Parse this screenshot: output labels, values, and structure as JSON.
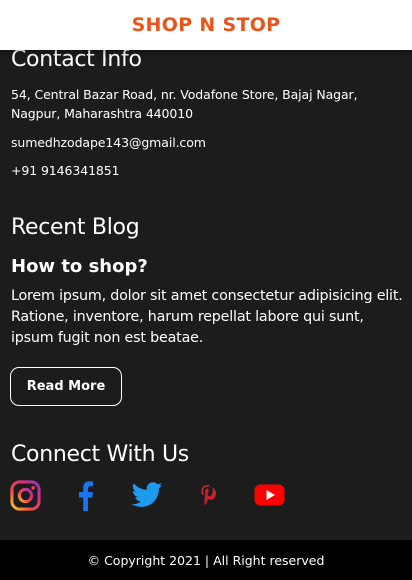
{
  "header": {
    "brand": "SHOP N STOP"
  },
  "contact": {
    "title": "Contact Info",
    "address_line1": "54, Central Bazar Road, nr. Vodafone Store, Bajaj Nagar,",
    "address_line2": "Nagpur, Maharashtra 440010",
    "email": "sumedhzodape143@gmail.com",
    "phone": "+91 9146341851"
  },
  "blog": {
    "title": "Recent Blog",
    "post_title": "How to shop?",
    "post_body": "Lorem ipsum, dolor sit amet consectetur adipisicing elit. Ratione, inventore, harum repellat labore qui sunt, ipsum fugit non est beatae.",
    "read_more_label": "Read More"
  },
  "social": {
    "title": "Connect With Us",
    "icons": [
      "instagram-icon",
      "facebook-icon",
      "twitter-icon",
      "pinterest-icon",
      "youtube-icon"
    ]
  },
  "colors": {
    "brand": "#e8541a",
    "background": "#1c1c1c",
    "footer": "#000000",
    "facebook": "#1877f2",
    "twitter": "#1d9bf0",
    "pinterest": "#c8232c",
    "youtube": "#ff0000"
  },
  "footer": {
    "copyright": "© Copyright 2021 | All Right reserved"
  }
}
